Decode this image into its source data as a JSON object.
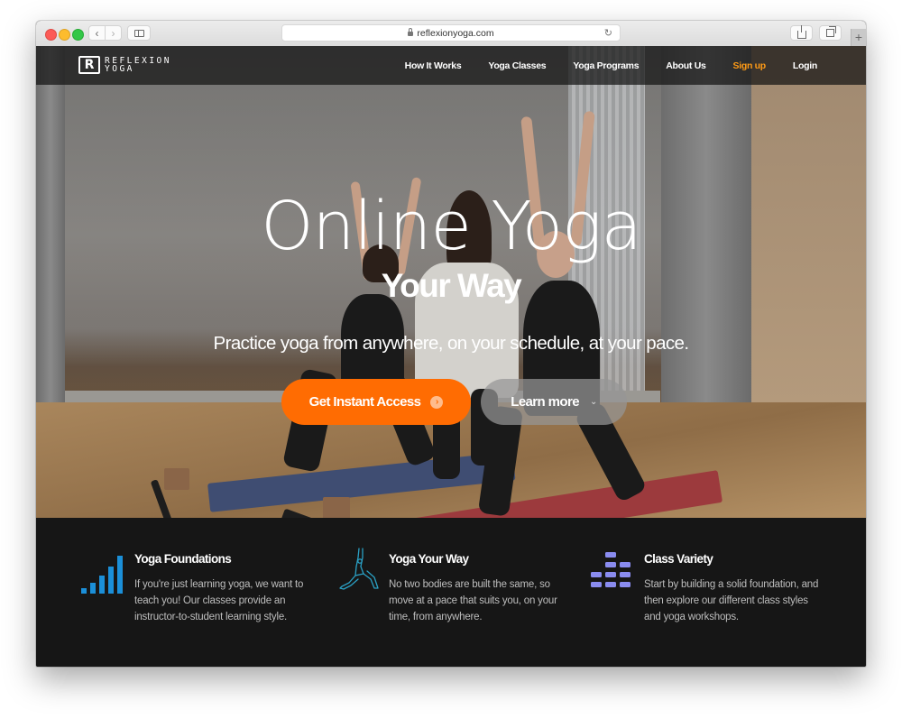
{
  "browser": {
    "url": "reflexionyoga.com",
    "buttons": {
      "back": "‹",
      "forward": "›",
      "reload": "↻",
      "new_tab": "+"
    }
  },
  "site": {
    "logo": {
      "mark": "R",
      "line1": "REFLEXION",
      "line2": "YOGA"
    },
    "nav": {
      "items": [
        {
          "label": "How It Works"
        },
        {
          "label": "Yoga Classes"
        },
        {
          "label": "Yoga Programs"
        },
        {
          "label": "About Us"
        },
        {
          "label": "Sign up",
          "highlight": true
        },
        {
          "label": "Login"
        }
      ]
    },
    "hero": {
      "title": "Online Yoga",
      "subtitle": "Your Way",
      "tagline": "Practice yoga from anywhere, on your schedule, at your pace.",
      "primary_cta": {
        "label": "Get Instant Access",
        "icon": "arrow-circle-right-icon"
      },
      "secondary_cta": {
        "label": "Learn more",
        "icon": "chevron-down-icon"
      }
    },
    "features": [
      {
        "icon": "signal-bars-icon",
        "title": "Yoga Foundations",
        "description": "If you're just learning yoga, we want to teach you! Our classes provide an instructor-to-student learning style."
      },
      {
        "icon": "yoga-pose-icon",
        "title": "Yoga Your Way",
        "description": "No two bodies are built the same, so move at a pace that suits you, on your time, from anywhere."
      },
      {
        "icon": "equalizer-blocks-icon",
        "title": "Class Variety",
        "description": "Start by building a solid foundation, and then explore our different class styles and yoga workshops."
      }
    ],
    "colors": {
      "accent_orange": "#ff6c02",
      "signup_orange": "#ff9b16",
      "foundations_blue": "#1b8fd8",
      "pose_teal": "#2aa0c4",
      "variety_purple": "#8a8cf0",
      "footer_bg": "#161616"
    }
  }
}
